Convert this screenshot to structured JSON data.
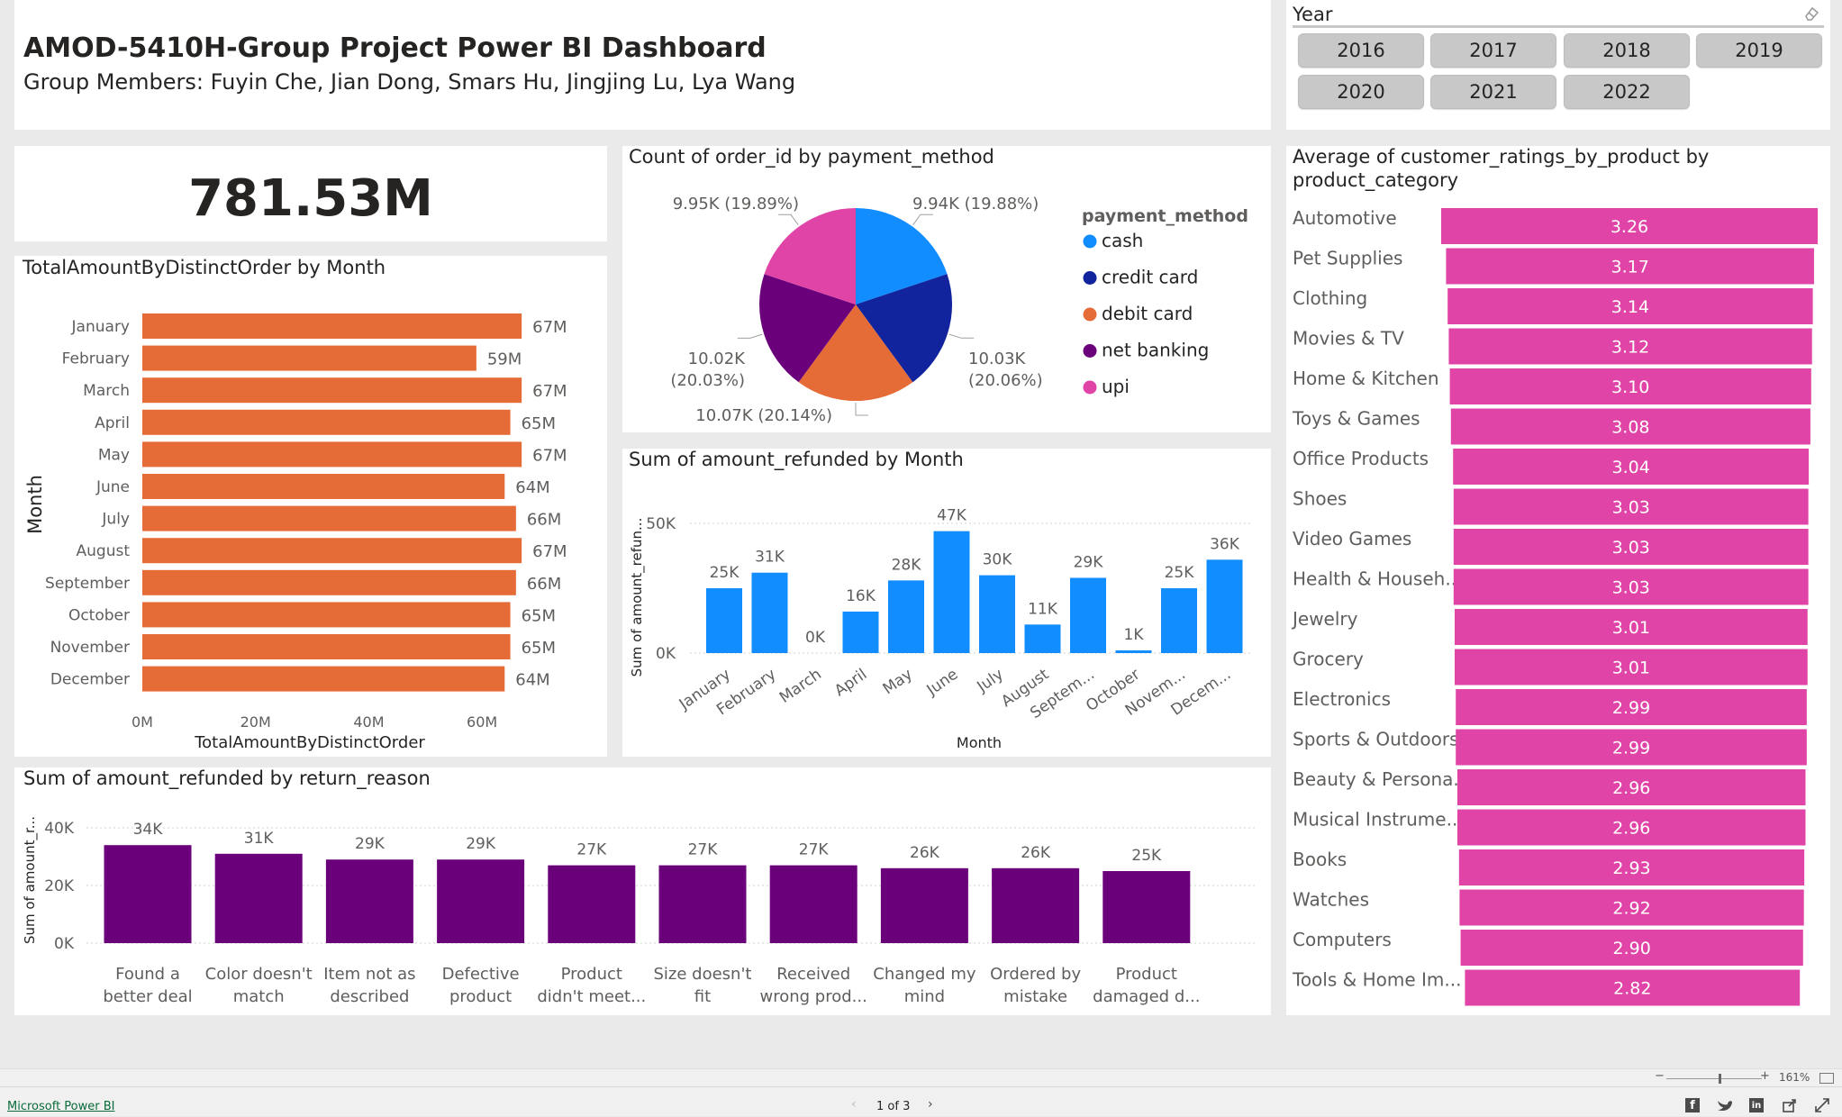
{
  "header": {
    "title": "AMOD-5410H-Group Project  Power BI Dashboard",
    "subtitle": "Group Members: Fuyin Che, Jian Dong, Smars Hu, Jingjing Lu, Lya Wang"
  },
  "year_slicer": {
    "label": "Year",
    "years": [
      "2016",
      "2017",
      "2018",
      "2019",
      "2020",
      "2021",
      "2022"
    ]
  },
  "kpi": {
    "value": "781.53M"
  },
  "footer": {
    "link": "Microsoft Power BI",
    "pager": "1 of 3",
    "zoom": "161%"
  },
  "colors": {
    "orange": "#e66c37",
    "blue": "#118dff",
    "navy": "#12239e",
    "purple": "#6b007b",
    "pink": "#e044a7"
  },
  "chart_data": [
    {
      "id": "month_total",
      "type": "bar",
      "orientation": "horizontal",
      "title": "TotalAmountByDistinctOrder by Month",
      "xlabel": "TotalAmountByDistinctOrder",
      "ylabel": "Month",
      "categories": [
        "January",
        "February",
        "March",
        "April",
        "May",
        "June",
        "July",
        "August",
        "September",
        "October",
        "November",
        "December"
      ],
      "values": [
        67,
        59,
        67,
        65,
        67,
        64,
        66,
        67,
        66,
        65,
        65,
        64
      ],
      "data_labels": [
        "67M",
        "59M",
        "67M",
        "65M",
        "67M",
        "64M",
        "66M",
        "67M",
        "66M",
        "65M",
        "65M",
        "64M"
      ],
      "xticks": [
        "0M",
        "20M",
        "40M",
        "60M"
      ],
      "xlim": [
        0,
        70
      ],
      "unit": "M"
    },
    {
      "id": "payment_pie",
      "type": "pie",
      "title": "Count of order_id by payment_method",
      "legend_title": "payment_method",
      "categories": [
        "cash",
        "credit card",
        "debit card",
        "net banking",
        "upi"
      ],
      "values": [
        9.94,
        10.03,
        10.07,
        10.02,
        9.95
      ],
      "data_labels": [
        "9.94K (19.88%)",
        "10.03K (20.06%)",
        "10.07K (20.14%)",
        "10.02K (20.03%)",
        "9.95K (19.89%)"
      ],
      "legend_position": "right"
    },
    {
      "id": "refund_month",
      "type": "bar",
      "title": "Sum of amount_refunded by Month",
      "xlabel": "Month",
      "ylabel": "Sum of amount_refun...",
      "categories": [
        "January",
        "February",
        "March",
        "April",
        "May",
        "June",
        "July",
        "August",
        "Septem...",
        "October",
        "Novem...",
        "Decem..."
      ],
      "values": [
        25,
        31,
        0,
        16,
        28,
        47,
        30,
        11,
        29,
        1,
        25,
        36
      ],
      "data_labels": [
        "25K",
        "31K",
        "0K",
        "16K",
        "28K",
        "47K",
        "30K",
        "11K",
        "29K",
        "1K",
        "25K",
        "36K"
      ],
      "yticks": [
        "0K",
        "50K"
      ],
      "ylim": [
        0,
        50
      ],
      "unit": "K"
    },
    {
      "id": "refund_reason",
      "type": "bar",
      "title": "Sum of amount_refunded by return_reason",
      "ylabel": "Sum of amount_r...",
      "categories": [
        [
          "Found a",
          "better deal"
        ],
        [
          "Color doesn't",
          "match"
        ],
        [
          "Item not as",
          "described"
        ],
        [
          "Defective",
          "product"
        ],
        [
          "Product",
          "didn't meet..."
        ],
        [
          "Size doesn't",
          "fit"
        ],
        [
          "Received",
          "wrong prod..."
        ],
        [
          "Changed my",
          "mind"
        ],
        [
          "Ordered by",
          "mistake"
        ],
        [
          "Product",
          "damaged d..."
        ]
      ],
      "values": [
        34,
        31,
        29,
        29,
        27,
        27,
        27,
        26,
        26,
        25
      ],
      "data_labels": [
        "34K",
        "31K",
        "29K",
        "29K",
        "27K",
        "27K",
        "27K",
        "26K",
        "26K",
        "25K"
      ],
      "yticks": [
        "0K",
        "20K",
        "40K"
      ],
      "ylim": [
        0,
        40
      ],
      "unit": "K"
    },
    {
      "id": "ratings_category",
      "type": "bar",
      "orientation": "horizontal",
      "title": "Average of customer_ratings_by_product by product_category",
      "title_lines": [
        "Average of customer_ratings_by_product by",
        "product_category"
      ],
      "categories": [
        "Automotive",
        "Pet Supplies",
        "Clothing",
        "Movies & TV",
        "Home & Kitchen",
        "Toys & Games",
        "Office Products",
        "Shoes",
        "Video Games",
        "Health & Househ...",
        "Jewelry",
        "Grocery",
        "Electronics",
        "Sports & Outdoors",
        "Beauty & Persona...",
        "Musical Instrume...",
        "Books",
        "Watches",
        "Computers",
        "Tools & Home Im..."
      ],
      "values": [
        3.26,
        3.17,
        3.14,
        3.12,
        3.1,
        3.08,
        3.04,
        3.03,
        3.03,
        3.03,
        3.01,
        3.01,
        2.99,
        2.99,
        2.96,
        2.96,
        2.93,
        2.92,
        2.9,
        2.82
      ],
      "data_labels": [
        "3.26",
        "3.17",
        "3.14",
        "3.12",
        "3.10",
        "3.08",
        "3.04",
        "3.03",
        "3.03",
        "3.03",
        "3.01",
        "3.01",
        "2.99",
        "2.99",
        "2.96",
        "2.96",
        "2.93",
        "2.92",
        "2.90",
        "2.82"
      ]
    }
  ]
}
